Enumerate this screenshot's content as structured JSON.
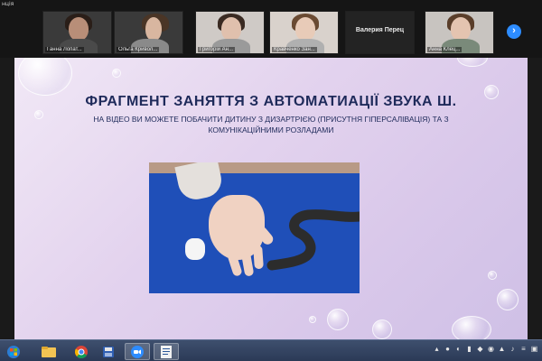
{
  "window": {
    "label": "нція"
  },
  "participants": [
    {
      "name": "Ганна Лопат..."
    },
    {
      "name": "Ольга Кривол..."
    },
    {
      "name": "Григорій Ан..."
    },
    {
      "name": "Кравченко Зан..."
    },
    {
      "name": "Валерия Перец"
    },
    {
      "name": "Анна Клец..."
    }
  ],
  "gallery": {
    "next_icon": "chevron-right-icon",
    "next_glyph": "›"
  },
  "slide": {
    "title": "ФРАГМЕНТ ЗАНЯТТЯ З АВТОМАТИАЦІЇ ЗВУКА Ш.",
    "subtitle": "НА ВІДЕО ВИ МОЖЕТЕ ПОБАЧИТИ ДИТИНУ З ДИЗАРТРІЄЮ (ПРИСУТНЯ ГІПЕРСАЛІВАЦІЯ) ТА З КОМУНІКАЦІЙНИМИ РОЗЛАДАМИ"
  },
  "taskbar": {
    "items": [
      {
        "icon": "start-button-icon"
      },
      {
        "icon": "folder-icon"
      },
      {
        "icon": "chrome-icon"
      },
      {
        "icon": "save-icon"
      },
      {
        "icon": "zoom-icon"
      },
      {
        "icon": "document-icon"
      }
    ]
  },
  "colors": {
    "title": "#1e2a5a",
    "accent": "#2d8cff",
    "photo_bg": "#1f4fb8"
  }
}
